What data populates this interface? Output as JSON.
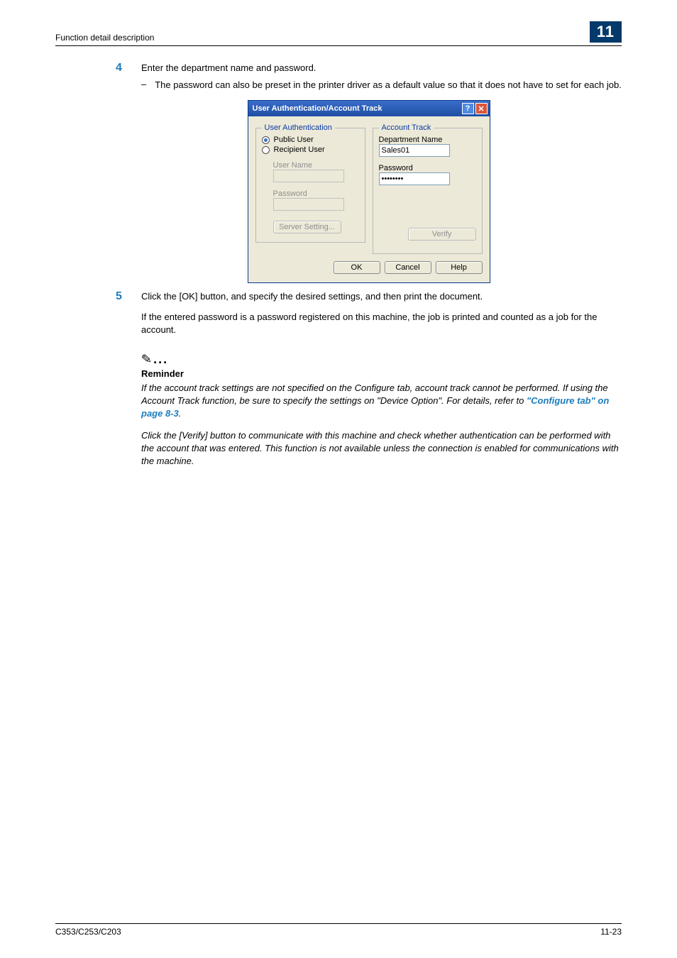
{
  "header": {
    "title": "Function detail description",
    "chapter": "11"
  },
  "step4": {
    "number": "4",
    "text": "Enter the department name and password.",
    "sub_dash": "–",
    "sub_text": "The password can also be preset in the printer driver as a default value so that it does not have to set for each job."
  },
  "dialog": {
    "title": "User Authentication/Account Track",
    "help_glyph": "?",
    "close_glyph": "✕",
    "user_auth": {
      "legend": "User Authentication",
      "public_user_label": "Public User",
      "recipient_user_label": "Recipient User",
      "user_name_label": "User Name",
      "password_label": "Password",
      "server_setting_label": "Server Setting..."
    },
    "account_track": {
      "legend": "Account Track",
      "dept_name_label": "Department Name",
      "dept_name_value": "Sales01",
      "password_label": "Password",
      "password_value": "••••••••",
      "verify_label": "Verify"
    },
    "buttons": {
      "ok": "OK",
      "cancel": "Cancel",
      "help": "Help"
    }
  },
  "step5": {
    "number": "5",
    "text": "Click the [OK] button, and specify the desired settings, and then print the document.",
    "para": "If the entered password is a password registered on this machine, the job is printed and counted as a job for the account."
  },
  "reminder": {
    "title": "Reminder",
    "body1a": "If the account track settings are not specified on the Configure tab, account track cannot be performed. If using the Account Track function, be sure to specify the settings on \"Device Option\". For details, refer to ",
    "body1b_link": "\"Configure tab\" on page 8-3",
    "body1c": ".",
    "body2": "Click the [Verify] button to communicate with this machine and check whether authentication can be performed with the account that was entered. This function is not available unless the connection is enabled for communications with the machine."
  },
  "footer": {
    "left": "C353/C253/C203",
    "right": "11-23"
  }
}
